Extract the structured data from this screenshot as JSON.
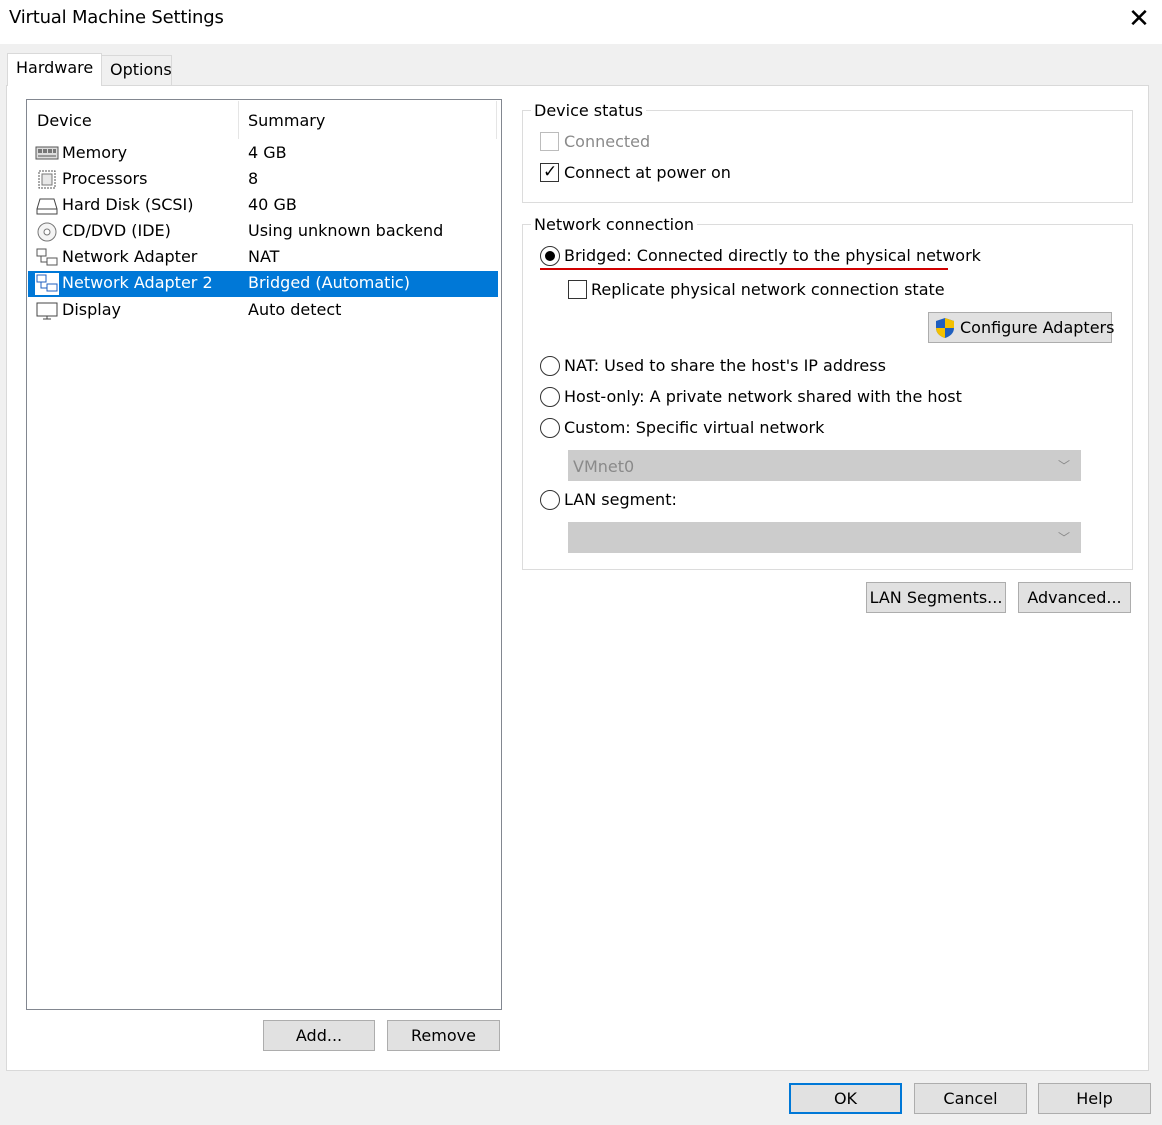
{
  "window": {
    "title": "Virtual Machine Settings",
    "close_symbol": "✕"
  },
  "tabs": [
    {
      "label": "Hardware",
      "active": true
    },
    {
      "label": "Options",
      "active": false
    }
  ],
  "device_table": {
    "headers": {
      "device": "Device",
      "summary": "Summary"
    },
    "rows": [
      {
        "name": "Memory",
        "summary": "4 GB",
        "icon": "memory-icon"
      },
      {
        "name": "Processors",
        "summary": "8",
        "icon": "processor-icon"
      },
      {
        "name": "Hard Disk (SCSI)",
        "summary": "40 GB",
        "icon": "hard-disk-icon"
      },
      {
        "name": "CD/DVD (IDE)",
        "summary": "Using unknown backend",
        "icon": "cd-dvd-icon"
      },
      {
        "name": "Network Adapter",
        "summary": "NAT",
        "icon": "network-adapter-icon"
      },
      {
        "name": "Network Adapter 2",
        "summary": "Bridged (Automatic)",
        "icon": "network-adapter-icon",
        "selected": true
      },
      {
        "name": "Display",
        "summary": "Auto detect",
        "icon": "display-icon"
      }
    ]
  },
  "left_buttons": {
    "add": "Add...",
    "remove": "Remove"
  },
  "device_status": {
    "label": "Device status",
    "connected": {
      "label": "Connected",
      "checked": false,
      "enabled": false
    },
    "connect_at_power_on": {
      "label": "Connect at power on",
      "checked": true
    }
  },
  "network_connection": {
    "label": "Network connection",
    "bridged": {
      "label": "Bridged: Connected directly to the physical network",
      "selected": true
    },
    "replicate": {
      "label": "Replicate physical network connection state",
      "checked": false
    },
    "configure_adapters": "Configure Adapters",
    "nat": {
      "label": "NAT: Used to share the host's IP address",
      "selected": false
    },
    "host_only": {
      "label": "Host-only: A private network shared with the host",
      "selected": false
    },
    "custom": {
      "label": "Custom: Specific virtual network",
      "selected": false
    },
    "custom_select": {
      "value": "VMnet0",
      "enabled": false
    },
    "lan_segment": {
      "label": "LAN segment:",
      "selected": false
    },
    "lan_segment_select": {
      "value": "",
      "enabled": false
    }
  },
  "right_buttons": {
    "lan_segments": "LAN Segments...",
    "advanced": "Advanced..."
  },
  "footer_buttons": {
    "ok": "OK",
    "cancel": "Cancel",
    "help": "Help"
  },
  "colors": {
    "selection": "#0078d7",
    "highlight_underline": "#d10000",
    "shield_blue": "#1f5fbf",
    "shield_yellow": "#f3c000"
  }
}
